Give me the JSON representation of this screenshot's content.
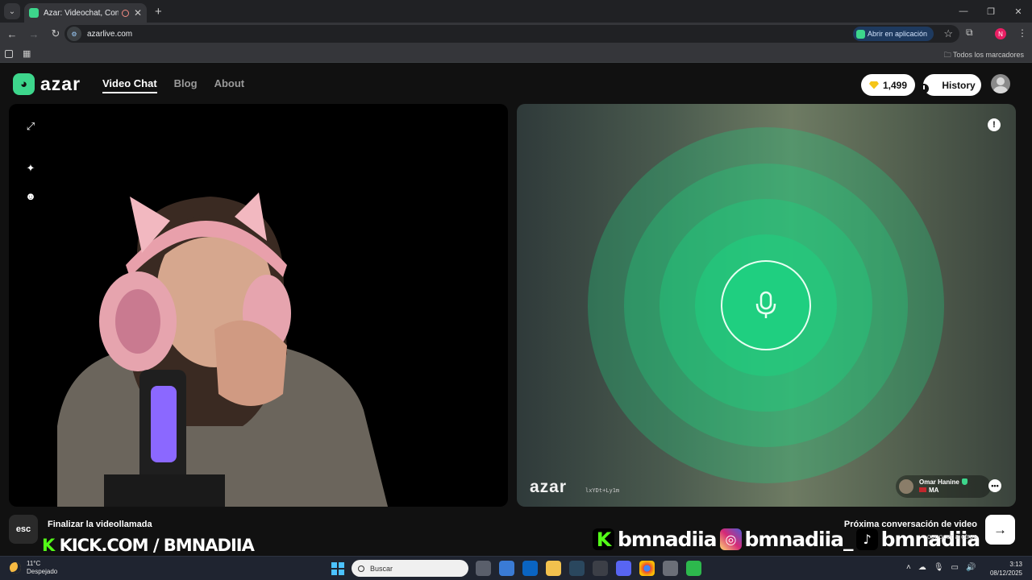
{
  "browser": {
    "tab_title": "Azar: Videochat, Conoce A",
    "tab_close": "✕",
    "new_tab": "+",
    "url": "azarlive.com",
    "open_app": "Abrir en aplicación",
    "all_bookmarks": "Todos los marcadores",
    "profile_initial": "N"
  },
  "azar": {
    "logo_text": "azar",
    "nav": {
      "video_chat": "Video Chat",
      "blog": "Blog",
      "about": "About"
    },
    "gems": "1,499",
    "history": "History",
    "left_panel": {
      "icons": [
        "expand-icon",
        "sparkle-icon",
        "face-filter-icon"
      ]
    },
    "right_panel": {
      "watermark": "azar",
      "watermark_id": "lxYDt+Ly1m",
      "peer_name": "Omar Hanine",
      "peer_country": "MA",
      "accent": "#1fcf80"
    },
    "bottom": {
      "esc": "esc",
      "end_call": "Finalizar la videollamada",
      "kick_text": "KICK.COM / BMNADIIA",
      "next_title": "Próxima conversación de video",
      "next_sub": "conocer a otros"
    },
    "socials": [
      "bmnadiia",
      "bmnadiia_",
      "bmnadiia"
    ]
  },
  "taskbar": {
    "temp": "11°C",
    "weather": "Despejado",
    "search": "Buscar",
    "time": "3:13",
    "date": "08/12/2025"
  }
}
